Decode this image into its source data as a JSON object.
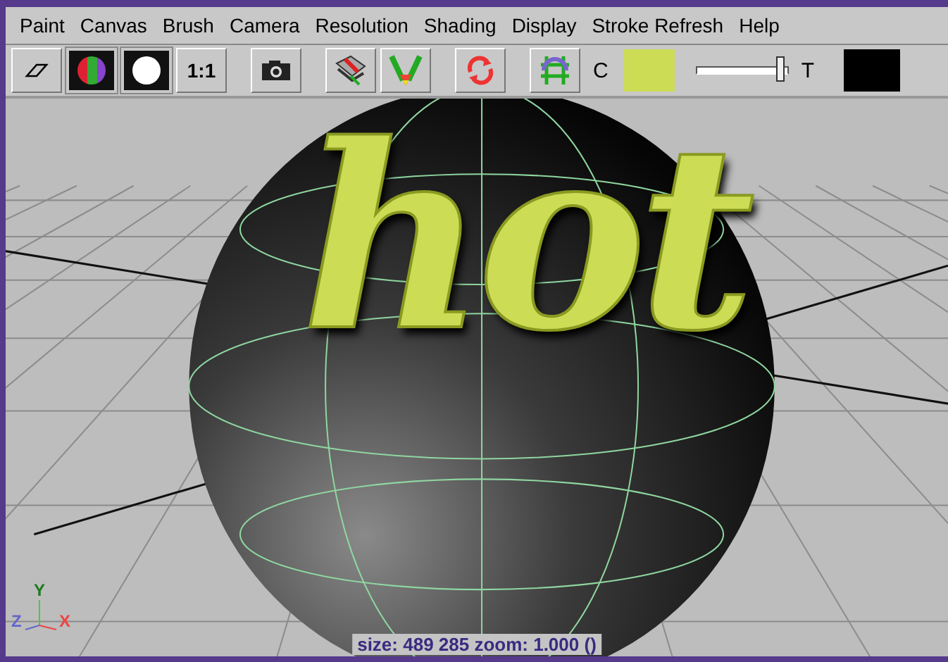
{
  "menu": [
    "Paint",
    "Canvas",
    "Brush",
    "Camera",
    "Resolution",
    "Shading",
    "Display",
    "Stroke Refresh",
    "Help"
  ],
  "toolbar": {
    "tools": [
      {
        "kind": "eraser"
      },
      {
        "kind": "rgb"
      },
      {
        "kind": "alpha"
      },
      {
        "kind": "ratio",
        "label": "1:1"
      },
      {
        "kind": "camera"
      },
      {
        "kind": "brush-get"
      },
      {
        "kind": "brush-set"
      },
      {
        "kind": "refresh"
      },
      {
        "kind": "wrap"
      }
    ],
    "color_label": "C",
    "swatches": [
      {
        "color": "#cddc55"
      },
      {
        "color": "#000000"
      }
    ],
    "slider": {
      "level": 0.95
    },
    "transparency_label": "T"
  },
  "viewport": {
    "stroke_text": "hot",
    "axes": {
      "y": "Y",
      "z": "Z",
      "x": "X"
    },
    "status": "size: 489 285 zoom: 1.000 ()"
  }
}
